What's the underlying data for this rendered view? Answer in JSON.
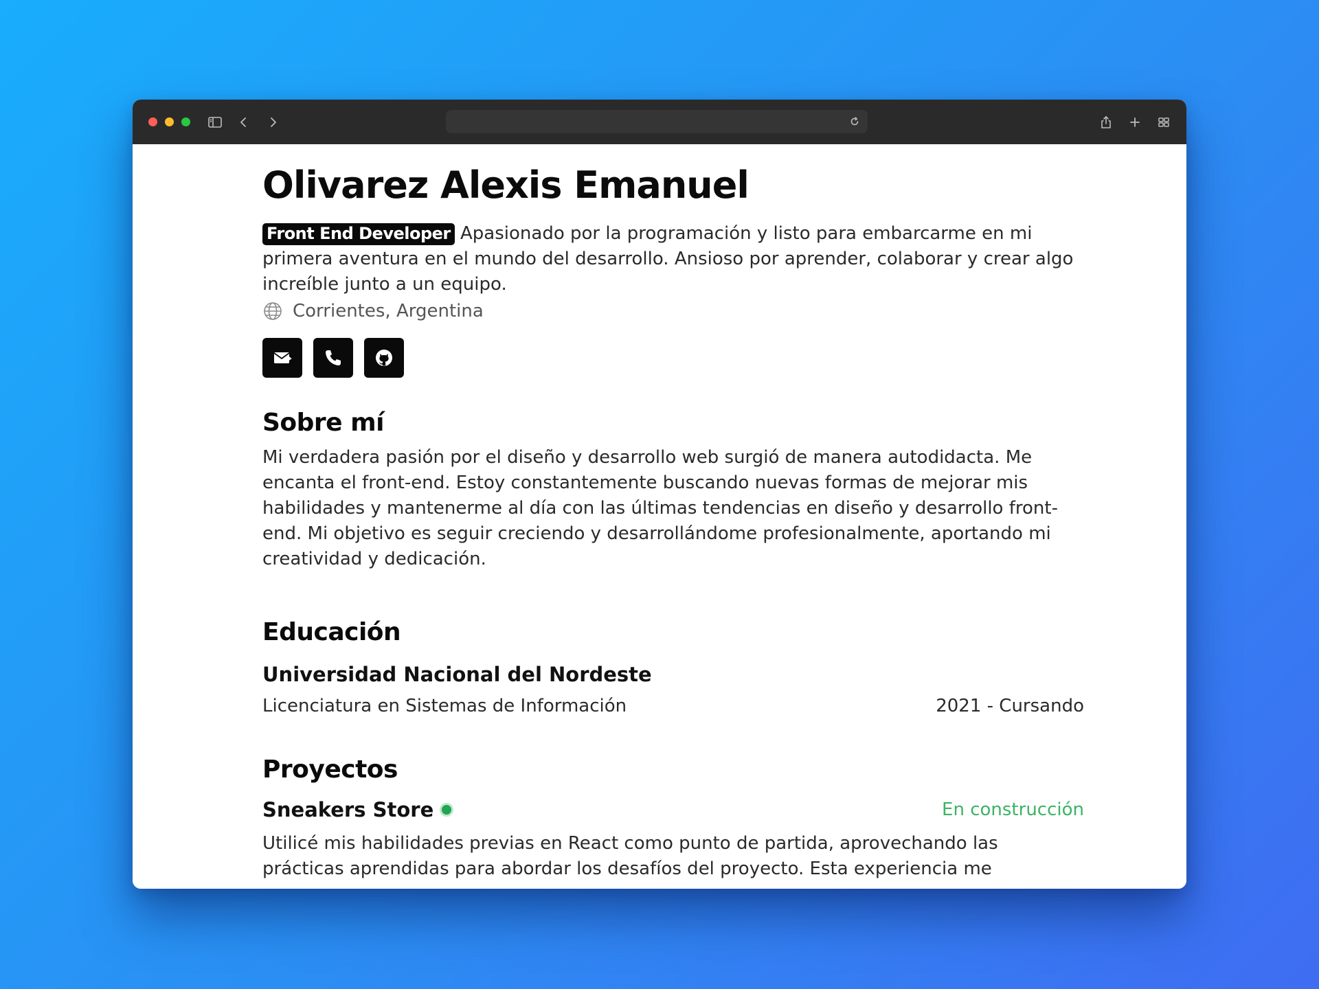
{
  "browser": {
    "icons": {
      "sidebar": "sidebar-icon",
      "back": "chevron-left-icon",
      "forward": "chevron-right-icon",
      "reload": "reload-icon",
      "share": "share-icon",
      "new_tab": "plus-icon",
      "tabs": "tab-overview-icon"
    },
    "colors": {
      "toolbar": "#2b2a2a",
      "close": "#fe5f57",
      "minimize": "#febc2e",
      "zoom": "#28c840"
    }
  },
  "profile": {
    "name": "Olivarez Alexis Emanuel",
    "role_badge": "Front End Developer",
    "intro": "Apasionado por la programación y listo para embarcarme en mi primera aventura en el mundo del desarrollo. Ansioso por aprender, colaborar y crear algo increíble junto a un equipo.",
    "location": "Corrientes, Argentina",
    "location_icon": "globe-icon",
    "socials": [
      {
        "name": "email",
        "icon": "mail-icon"
      },
      {
        "name": "phone",
        "icon": "phone-icon"
      },
      {
        "name": "github",
        "icon": "github-icon"
      }
    ]
  },
  "about": {
    "title": "Sobre mí",
    "text": "Mi verdadera pasión por el diseño y desarrollo web surgió de manera autodidacta. Me encanta el front-end. Estoy constantemente buscando nuevas formas de mejorar mis habilidades y mantenerme al día con las últimas tendencias en diseño y desarrollo front-end. Mi objetivo es seguir creciendo y desarrollándome profesionalmente, aportando mi creatividad y dedicación."
  },
  "education": {
    "title": "Educación",
    "items": [
      {
        "institution": "Universidad Nacional del Nordeste",
        "degree": "Licenciatura en Sistemas de Información",
        "period": "2021 - Cursando"
      }
    ]
  },
  "projects": {
    "title": "Proyectos",
    "items": [
      {
        "name": "Sneakers Store",
        "status": "En construcción",
        "status_color": "#3cb464",
        "description": "Utilicé mis habilidades previas en React como punto de partida, aprovechando las prácticas aprendidas para abordar los desafíos del proyecto. Esta experiencia me"
      }
    ]
  }
}
